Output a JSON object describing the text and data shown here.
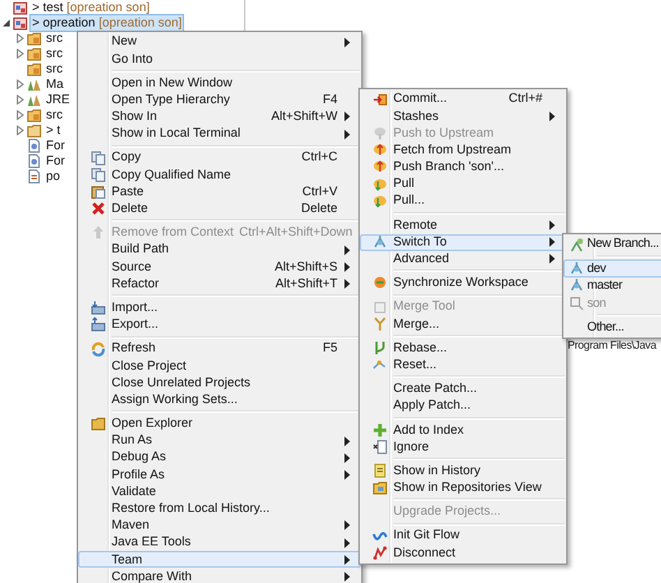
{
  "tree": [
    {
      "label": "> test",
      "decoration": "[opreation son]",
      "selected": false
    },
    {
      "label": "> opreation",
      "decoration": "[opreation son]",
      "expanded": true,
      "selected": true,
      "children": [
        {
          "label": "src",
          "expanded": false,
          "selected": false
        },
        {
          "label": "src",
          "expanded": false,
          "selected": false
        },
        {
          "label": "src",
          "selected": false
        },
        {
          "label": "Ma",
          "expanded": false,
          "selected": false
        },
        {
          "label": "JRE",
          "expanded": false,
          "selected": false
        },
        {
          "label": "src",
          "expanded": false,
          "selected": false
        },
        {
          "label": "> t",
          "expanded": false,
          "selected": false
        },
        {
          "label": "For",
          "selected": false
        },
        {
          "label": "For",
          "selected": false
        },
        {
          "label": "po",
          "selected": false
        }
      ]
    }
  ],
  "background_text": "Program Files\\Java",
  "main_menu": {
    "items": [
      {
        "kind": "item",
        "label": "New",
        "submenu": true,
        "selected": false,
        "disabled": false
      },
      {
        "kind": "item",
        "label": "Go Into",
        "selected": false,
        "disabled": false
      },
      {
        "kind": "separator"
      },
      {
        "kind": "item",
        "label": "Open in New Window",
        "selected": false,
        "disabled": false
      },
      {
        "kind": "item",
        "label": "Open Type Hierarchy",
        "shortcut": "F4",
        "selected": false,
        "disabled": false
      },
      {
        "kind": "item",
        "label": "Show In",
        "shortcut": "Alt+Shift+W",
        "submenu": true,
        "selected": false,
        "disabled": false
      },
      {
        "kind": "item",
        "label": "Show in Local Terminal",
        "submenu": true,
        "selected": false,
        "disabled": false
      },
      {
        "kind": "separator"
      },
      {
        "kind": "item",
        "label": "Copy",
        "shortcut": "Ctrl+C",
        "selected": false,
        "disabled": false
      },
      {
        "kind": "item",
        "label": "Copy Qualified Name",
        "selected": false,
        "disabled": false
      },
      {
        "kind": "item",
        "label": "Paste",
        "shortcut": "Ctrl+V",
        "selected": false,
        "disabled": false
      },
      {
        "kind": "item",
        "label": "Delete",
        "shortcut": "Delete",
        "selected": false,
        "disabled": false
      },
      {
        "kind": "separator"
      },
      {
        "kind": "item",
        "label": "Remove from Context",
        "shortcut": "Ctrl+Alt+Shift+Down",
        "selected": false,
        "disabled": true
      },
      {
        "kind": "item",
        "label": "Build Path",
        "submenu": true,
        "selected": false,
        "disabled": false
      },
      {
        "kind": "item",
        "label": "Source",
        "shortcut": "Alt+Shift+S",
        "submenu": true,
        "selected": false,
        "disabled": false
      },
      {
        "kind": "item",
        "label": "Refactor",
        "shortcut": "Alt+Shift+T",
        "submenu": true,
        "selected": false,
        "disabled": false
      },
      {
        "kind": "separator"
      },
      {
        "kind": "item",
        "label": "Import...",
        "selected": false,
        "disabled": false
      },
      {
        "kind": "item",
        "label": "Export...",
        "selected": false,
        "disabled": false
      },
      {
        "kind": "separator"
      },
      {
        "kind": "item",
        "label": "Refresh",
        "shortcut": "F5",
        "selected": false,
        "disabled": false
      },
      {
        "kind": "item",
        "label": "Close Project",
        "selected": false,
        "disabled": false
      },
      {
        "kind": "item",
        "label": "Close Unrelated Projects",
        "selected": false,
        "disabled": false
      },
      {
        "kind": "item",
        "label": "Assign Working Sets...",
        "selected": false,
        "disabled": false
      },
      {
        "kind": "separator"
      },
      {
        "kind": "item",
        "label": "Open Explorer",
        "selected": false,
        "disabled": false
      },
      {
        "kind": "item",
        "label": "Run As",
        "submenu": true,
        "selected": false,
        "disabled": false
      },
      {
        "kind": "item",
        "label": "Debug As",
        "submenu": true,
        "selected": false,
        "disabled": false
      },
      {
        "kind": "item",
        "label": "Profile As",
        "submenu": true,
        "selected": false,
        "disabled": false
      },
      {
        "kind": "item",
        "label": "Validate",
        "selected": false,
        "disabled": false
      },
      {
        "kind": "item",
        "label": "Restore from Local History...",
        "selected": false,
        "disabled": false
      },
      {
        "kind": "item",
        "label": "Maven",
        "submenu": true,
        "selected": false,
        "disabled": false
      },
      {
        "kind": "item",
        "label": "Java EE Tools",
        "submenu": true,
        "selected": false,
        "disabled": false
      },
      {
        "kind": "item",
        "label": "Team",
        "submenu": true,
        "selected": true,
        "disabled": false
      },
      {
        "kind": "item",
        "label": "Compare With",
        "submenu": true,
        "selected": false,
        "disabled": false
      }
    ]
  },
  "team_menu": {
    "items": [
      {
        "kind": "item",
        "label": "Commit...",
        "shortcut": "Ctrl+#",
        "selected": false,
        "disabled": false
      },
      {
        "kind": "item",
        "label": "Stashes",
        "submenu": true,
        "selected": false,
        "disabled": false
      },
      {
        "kind": "item",
        "label": "Push to Upstream",
        "selected": false,
        "disabled": true
      },
      {
        "kind": "item",
        "label": "Fetch from Upstream",
        "selected": false,
        "disabled": false
      },
      {
        "kind": "item",
        "label": "Push Branch 'son'...",
        "selected": false,
        "disabled": false
      },
      {
        "kind": "item",
        "label": "Pull",
        "selected": false,
        "disabled": false
      },
      {
        "kind": "item",
        "label": "Pull...",
        "selected": false,
        "disabled": false
      },
      {
        "kind": "separator"
      },
      {
        "kind": "item",
        "label": "Remote",
        "submenu": true,
        "selected": false,
        "disabled": false
      },
      {
        "kind": "item",
        "label": "Switch To",
        "submenu": true,
        "selected": true,
        "disabled": false
      },
      {
        "kind": "item",
        "label": "Advanced",
        "submenu": true,
        "selected": false,
        "disabled": false
      },
      {
        "kind": "separator"
      },
      {
        "kind": "item",
        "label": "Synchronize Workspace",
        "selected": false,
        "disabled": false
      },
      {
        "kind": "separator"
      },
      {
        "kind": "item",
        "label": "Merge Tool",
        "selected": false,
        "disabled": true
      },
      {
        "kind": "item",
        "label": "Merge...",
        "selected": false,
        "disabled": false
      },
      {
        "kind": "separator"
      },
      {
        "kind": "item",
        "label": "Rebase...",
        "selected": false,
        "disabled": false
      },
      {
        "kind": "item",
        "label": "Reset...",
        "selected": false,
        "disabled": false
      },
      {
        "kind": "separator"
      },
      {
        "kind": "item",
        "label": "Create Patch...",
        "selected": false,
        "disabled": false
      },
      {
        "kind": "item",
        "label": "Apply Patch...",
        "selected": false,
        "disabled": false
      },
      {
        "kind": "separator"
      },
      {
        "kind": "item",
        "label": "Add to Index",
        "selected": false,
        "disabled": false
      },
      {
        "kind": "item",
        "label": "Ignore",
        "selected": false,
        "disabled": false
      },
      {
        "kind": "separator"
      },
      {
        "kind": "item",
        "label": "Show in History",
        "selected": false,
        "disabled": false
      },
      {
        "kind": "item",
        "label": "Show in Repositories View",
        "selected": false,
        "disabled": false
      },
      {
        "kind": "separator"
      },
      {
        "kind": "item",
        "label": "Upgrade Projects...",
        "selected": false,
        "disabled": true
      },
      {
        "kind": "separator"
      },
      {
        "kind": "item",
        "label": "Init Git Flow",
        "selected": false,
        "disabled": false
      },
      {
        "kind": "item",
        "label": "Disconnect",
        "selected": false,
        "disabled": false
      }
    ]
  },
  "switch_menu": {
    "items": [
      {
        "kind": "item",
        "label": "New Branch...",
        "selected": false,
        "disabled": false
      },
      {
        "kind": "separator"
      },
      {
        "kind": "item",
        "label": "dev",
        "selected": true,
        "disabled": false
      },
      {
        "kind": "item",
        "label": "master",
        "selected": false,
        "disabled": false
      },
      {
        "kind": "item",
        "label": "son",
        "selected": false,
        "disabled": true
      },
      {
        "kind": "separator"
      },
      {
        "kind": "item",
        "label": "Other...",
        "selected": false,
        "disabled": false
      }
    ]
  }
}
